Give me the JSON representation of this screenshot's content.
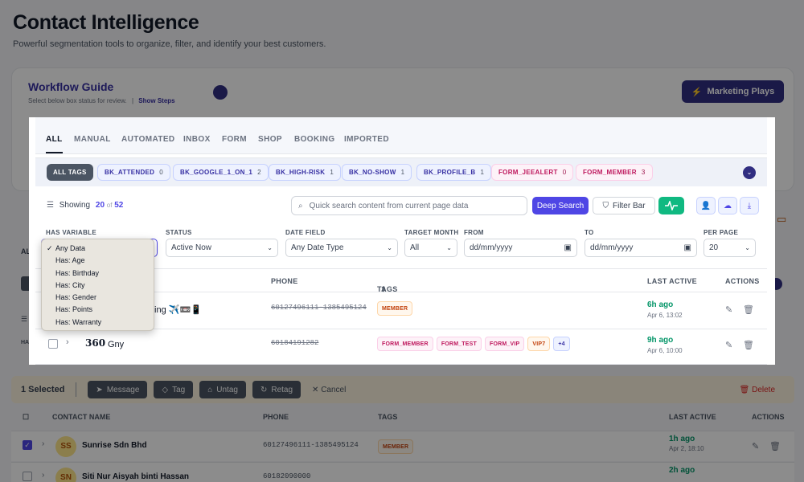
{
  "page": {
    "title": "Contact Intelligence",
    "subtitle": "Powerful segmentation tools to organize, filter, and identify your best customers."
  },
  "guide": {
    "title": "Workflow Guide",
    "subtitle": "Select below box status for review.",
    "separator": "|",
    "show_steps": "Show Steps",
    "marketing_plays": "Marketing Plays"
  },
  "tabs": [
    "ALL",
    "MANUAL",
    "AUTOMATED",
    "INBOX",
    "FORM",
    "SHOP",
    "BOOKING",
    "IMPORTED"
  ],
  "tag_chips": [
    {
      "label": "ALL TAGS",
      "count": "",
      "style": "dark"
    },
    {
      "label": "BK_ATTENDED",
      "count": "0",
      "style": "blue"
    },
    {
      "label": "BK_GOOGLE_1_ON_1",
      "count": "2",
      "style": "blue"
    },
    {
      "label": "BK_HIGH-RISK",
      "count": "1",
      "style": "blue"
    },
    {
      "label": "BK_NO-SHOW",
      "count": "1",
      "style": "blue"
    },
    {
      "label": "BK_PROFILE_B",
      "count": "1",
      "style": "blue"
    },
    {
      "label": "FORM_JEEALERT",
      "count": "0",
      "style": "pink"
    },
    {
      "label": "FORM_MEMBER",
      "count": "3",
      "style": "pink"
    }
  ],
  "toolbar": {
    "showing_label": "Showing",
    "showing_count": "20",
    "of_label": "of",
    "total": "52",
    "search_placeholder": "Quick search content from current page data",
    "deep_search": "Deep Search",
    "filter_bar": "Filter Bar"
  },
  "filters": {
    "has_variable_label": "HAS VARIABLE",
    "status_label": "STATUS",
    "status_value": "Active Now",
    "date_field_label": "DATE FIELD",
    "date_field_value": "Any Date Type",
    "target_month_label": "TARGET MONTH",
    "target_month_value": "All",
    "from_label": "FROM",
    "from_value": "dd/mm/yyyy",
    "to_label": "TO",
    "to_value": "dd/mm/yyyy",
    "per_page_label": "PER PAGE",
    "per_page_value": "20"
  },
  "has_variable_options": [
    "Any Data",
    "Has: Age",
    "Has: Birthday",
    "Has: City",
    "Has: Gender",
    "Has: Points",
    "Has: Warranty"
  ],
  "has_variable_selected": "Any Data",
  "table": {
    "headers": {
      "phone": "PHONE",
      "tags": "TAGS",
      "last_active": "LAST ACTIVE",
      "actions": "ACTIONS"
    },
    "rows": [
      {
        "name": "ting ✈️📼📱",
        "phone": "60127496111-1385495124",
        "tags": [
          "MEMBER"
        ],
        "last_active": "6h ago",
        "date": "Apr 6, 13:02"
      },
      {
        "logo": "360",
        "name": "Gny",
        "phone": "60184191282",
        "tags": [
          "FORM_MEMBER",
          "FORM_TEST",
          "FORM_VIP",
          "VIP7",
          "+4"
        ],
        "last_active": "9h ago",
        "date": "Apr 6, 10:00"
      }
    ]
  },
  "selection_bar": {
    "count": "1 Selected",
    "message": "Message",
    "tag": "Tag",
    "untag": "Untag",
    "retag": "Retag",
    "cancel": "Cancel",
    "delete": "Delete"
  },
  "bg_table": {
    "headers": {
      "name": "CONTACT NAME",
      "phone": "PHONE",
      "tags": "TAGS",
      "last_active": "LAST ACTIVE",
      "actions": "ACTIONS"
    },
    "rows": [
      {
        "initials": "SS",
        "name": "Sunrise Sdn Bhd",
        "phone": "60127496111-1385495124",
        "tag": "MEMBER",
        "last_active": "1h ago",
        "date": "Apr 2, 18:10"
      },
      {
        "initials": "SN",
        "name": "Siti Nur Aisyah binti Hassan",
        "phone": "60182090000",
        "last_active": "2h ago"
      }
    ],
    "left_tab_fragment": "AL",
    "left_label_fragment": "HA"
  },
  "colors": {
    "accent": "#4f46e5",
    "brand_dark": "#312e81",
    "success": "#10b981",
    "danger": "#dc2626"
  }
}
